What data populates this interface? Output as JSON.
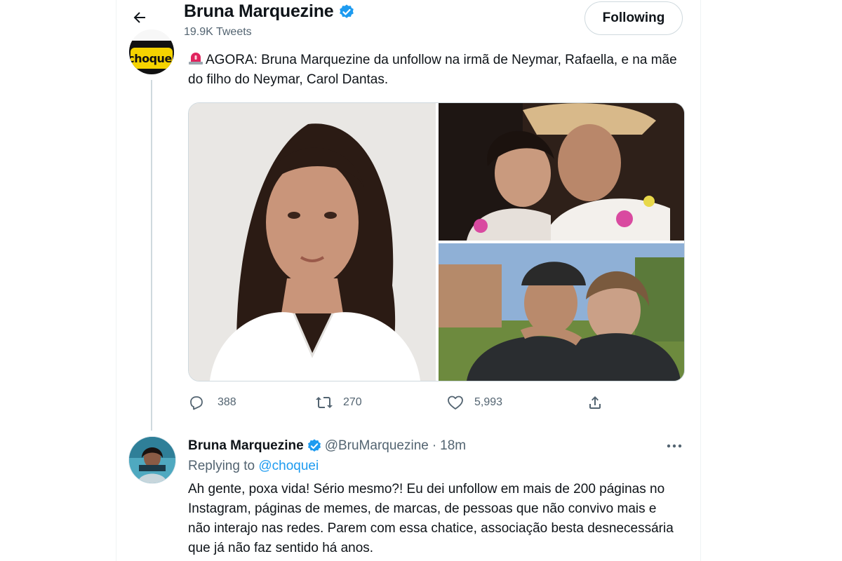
{
  "header": {
    "name": "Bruna Marquezine",
    "tweets_count": "19.9K Tweets",
    "follow_label": "Following"
  },
  "colors": {
    "accent": "#1d9bf0",
    "text_primary": "#0f1419",
    "text_secondary": "#536471",
    "border": "#cfd9de"
  },
  "quoted_tweet": {
    "avatar_text": "choquei",
    "text": "AGORA: Bruna Marquezine da unfollow na irmã de Neymar, Rafaella, e na mãe do filho do Neymar, Carol Dantas.",
    "leading_icon": "siren-icon",
    "media_count": 3,
    "actions": {
      "replies": "388",
      "retweets": "270",
      "likes": "5,993"
    }
  },
  "reply_tweet": {
    "name": "Bruna Marquezine",
    "handle": "@BruMarquezine",
    "time": "18m",
    "replying_prefix": "Replying to",
    "replying_to": "@choquei",
    "text": "Ah gente, poxa vida! Sério mesmo?! Eu dei unfollow em mais de 200 páginas no Instagram, páginas de memes, de marcas, de pessoas que não convivo mais e não interajo nas redes. Parem com essa chatice, associação besta desnecessária que já não faz sentido há anos."
  },
  "icons": [
    "back-arrow-icon",
    "verified-badge-icon",
    "reply-icon",
    "retweet-icon",
    "like-icon",
    "share-icon",
    "more-options-icon"
  ]
}
